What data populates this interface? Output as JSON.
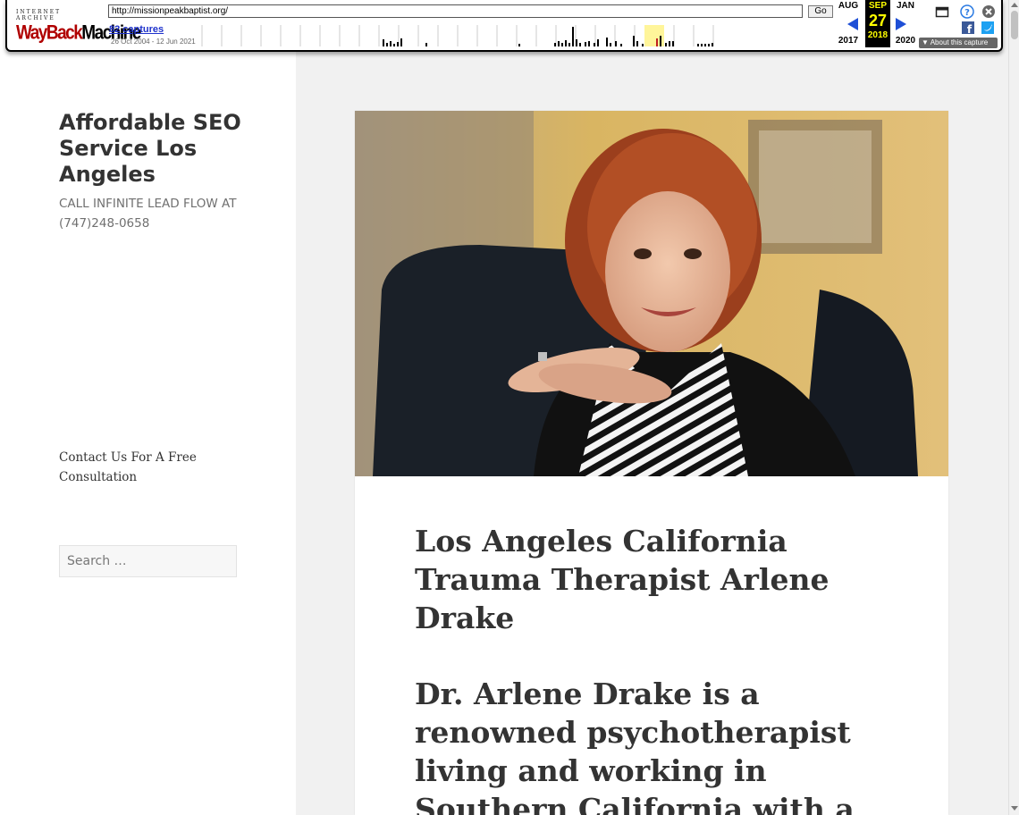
{
  "wayback": {
    "logo_top": "INTERNET ARCHIVE",
    "logo_way": "WayBack",
    "logo_machine": "Machine",
    "url": "http://missionpeakbaptist.org/",
    "go_label": "Go",
    "captures": "82 captures",
    "range": "26 Oct 2004 - 12 Jun 2021",
    "prev_month": "AUG",
    "current_month": "SEP",
    "next_month": "JAN",
    "current_day": "27",
    "prev_year": "2017",
    "current_year": "2018",
    "next_year": "2020",
    "about": "About this capture",
    "colors": {
      "accent": "#1e4fd6",
      "current_bg": "#000000",
      "current_fg": "#ffff00",
      "logo_red": "#b00000"
    }
  },
  "sidebar": {
    "site_title": "Affordable SEO Service Los Angeles",
    "site_description": "CALL INFINITE LEAD FLOW AT (747)248-0658",
    "contact_text": "Contact Us For A Free Consultation",
    "search_placeholder": "Search …"
  },
  "post": {
    "title": "Los Angeles California Trauma Therapist Arlene Drake",
    "body_heading": "Dr. Arlene Drake is a renowned psychotherapist living and working in Southern California with a"
  }
}
